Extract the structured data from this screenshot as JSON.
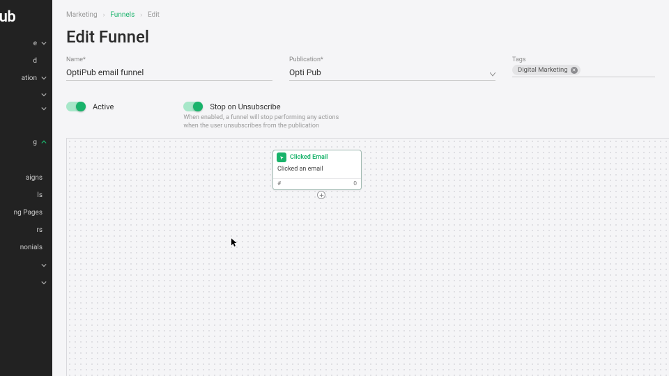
{
  "logo": "Pub",
  "sidebar": {
    "items": [
      {
        "label": "e",
        "chevron": true
      },
      {
        "label": "d",
        "chevron": false
      },
      {
        "label": "ation",
        "chevron": true
      },
      {
        "label": "",
        "chevron": true
      },
      {
        "label": "",
        "chevron": true
      },
      {
        "label": "g",
        "chevron": true,
        "expanded": true
      }
    ],
    "sub": [
      {
        "label": "aigns"
      },
      {
        "label": "ls"
      },
      {
        "label": "ng Pages"
      },
      {
        "label": "rs"
      },
      {
        "label": "nonials"
      }
    ],
    "tail": [
      {
        "label": "",
        "chevron": true
      },
      {
        "label": "",
        "chevron": true
      }
    ]
  },
  "breadcrumb": {
    "a": "Marketing",
    "b": "Funnels",
    "c": "Edit"
  },
  "page_title": "Edit Funnel",
  "form": {
    "name_label": "Name*",
    "name_value": "OptiPub email funnel",
    "pub_label": "Publication*",
    "pub_value": "Opti Pub",
    "tags_label": "Tags",
    "tag": "Digital Marketing"
  },
  "toggles": {
    "active": "Active",
    "stop": "Stop on Unsubscribe",
    "stop_help": "When enabled, a funnel will stop performing any actions when the user unsubscribes from the publication"
  },
  "node": {
    "title": "Clicked Email",
    "body": "Clicked an email",
    "foot_left": "#",
    "foot_right": "0"
  }
}
